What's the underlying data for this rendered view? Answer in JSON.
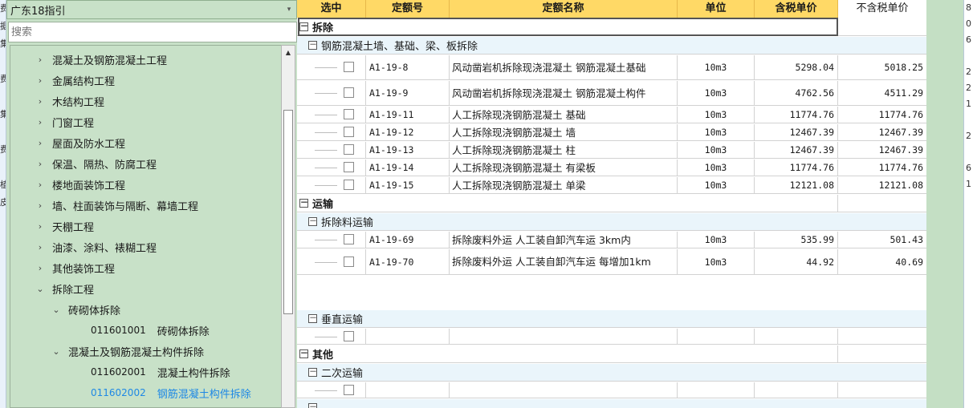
{
  "left_edge": {
    "chars": [
      "费",
      "据",
      "集",
      "",
      "费",
      "",
      "集",
      "",
      "费",
      "",
      "植",
      "皮"
    ]
  },
  "right_edge": {
    "chars": [
      "8",
      "0",
      "6",
      "",
      "2",
      "2",
      "1",
      "",
      "2",
      "",
      "6",
      "1"
    ]
  },
  "sidebar": {
    "dropdown": {
      "value": "广东18指引",
      "arrow": "▾"
    },
    "search": {
      "placeholder": "搜索"
    },
    "tree": [
      {
        "label": "混凝土及钢筋混凝土工程",
        "chevron": "›"
      },
      {
        "label": "金属结构工程",
        "chevron": "›"
      },
      {
        "label": "木结构工程",
        "chevron": "›"
      },
      {
        "label": "门窗工程",
        "chevron": "›"
      },
      {
        "label": "屋面及防水工程",
        "chevron": "›"
      },
      {
        "label": "保温、隔热、防腐工程",
        "chevron": "›"
      },
      {
        "label": "楼地面装饰工程",
        "chevron": "›"
      },
      {
        "label": "墙、柱面装饰与隔断、幕墙工程",
        "chevron": "›"
      },
      {
        "label": "天棚工程",
        "chevron": "›"
      },
      {
        "label": "油漆、涂料、裱糊工程",
        "chevron": "›"
      },
      {
        "label": "其他装饰工程",
        "chevron": "›"
      },
      {
        "label": "拆除工程",
        "chevron": "⌄"
      },
      {
        "label": "砖砌体拆除",
        "chevron": "⌄"
      },
      {
        "code": "011601001",
        "label": "砖砌体拆除"
      },
      {
        "label": "混凝土及钢筋混凝土构件拆除",
        "chevron": "⌄"
      },
      {
        "code": "011602001",
        "label": "混凝土构件拆除"
      },
      {
        "code": "011602002",
        "label": "钢筋混凝土构件拆除"
      }
    ]
  },
  "table": {
    "headers": [
      "选中",
      "定额号",
      "定额名称",
      "单位",
      "含税单价",
      "不含税单价"
    ],
    "expander": "－",
    "groups": {
      "g1": "拆除",
      "s1": "钢筋混凝土墙、基础、梁、板拆除",
      "g2": "运输",
      "s2": "拆除料运输",
      "s3": "垂直运输",
      "g3": "其他",
      "s4": "二次运输"
    },
    "rows": [
      {
        "code": "A1-19-8",
        "name": "风动凿岩机拆除现浇混凝土 钢筋混凝土基础",
        "unit": "10m3",
        "tax": "5298.04",
        "notax": "5018.25"
      },
      {
        "code": "A1-19-9",
        "name": "风动凿岩机拆除现浇混凝土 钢筋混凝土构件",
        "unit": "10m3",
        "tax": "4762.56",
        "notax": "4511.29"
      },
      {
        "code": "A1-19-11",
        "name": "人工拆除现浇钢筋混凝土 基础",
        "unit": "10m3",
        "tax": "11774.76",
        "notax": "11774.76"
      },
      {
        "code": "A1-19-12",
        "name": "人工拆除现浇钢筋混凝土 墙",
        "unit": "10m3",
        "tax": "12467.39",
        "notax": "12467.39"
      },
      {
        "code": "A1-19-13",
        "name": "人工拆除现浇钢筋混凝土 柱",
        "unit": "10m3",
        "tax": "12467.39",
        "notax": "12467.39"
      },
      {
        "code": "A1-19-14",
        "name": "人工拆除现浇钢筋混凝土 有梁板",
        "unit": "10m3",
        "tax": "11774.76",
        "notax": "11774.76"
      },
      {
        "code": "A1-19-15",
        "name": "人工拆除现浇钢筋混凝土 单梁",
        "unit": "10m3",
        "tax": "12121.08",
        "notax": "12121.08"
      },
      {
        "code": "A1-19-69",
        "name": "拆除废料外运 人工装自卸汽车运 3km内",
        "unit": "10m3",
        "tax": "535.99",
        "notax": "501.43"
      },
      {
        "code": "A1-19-70",
        "name": "拆除废料外运 人工装自卸汽车运 每增加1km",
        "unit": "10m3",
        "tax": "44.92",
        "notax": "40.69"
      }
    ]
  }
}
